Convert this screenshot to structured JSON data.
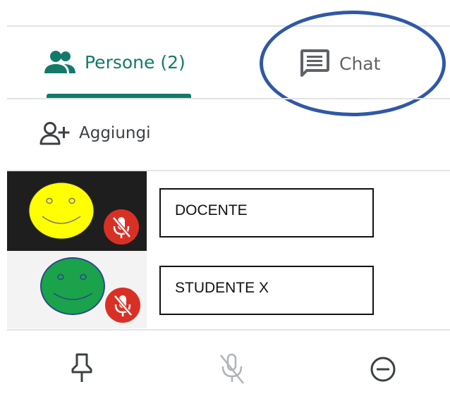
{
  "tabs": {
    "people_label": "Persone (2)",
    "chat_label": "Chat"
  },
  "add": {
    "label": "Aggiungi"
  },
  "participants": [
    {
      "name": "DOCENTE",
      "avatar_color": "#ffff00",
      "muted": true
    },
    {
      "name": "STUDENTE X",
      "avatar_color": "#1aa34a",
      "muted": true
    }
  ],
  "colors": {
    "accent": "#137a6a",
    "muted_badge": "#d93025",
    "annotation_outline": "#2f58a6"
  },
  "bottom_actions": [
    "pin-icon",
    "mic-off-icon",
    "remove-icon"
  ]
}
